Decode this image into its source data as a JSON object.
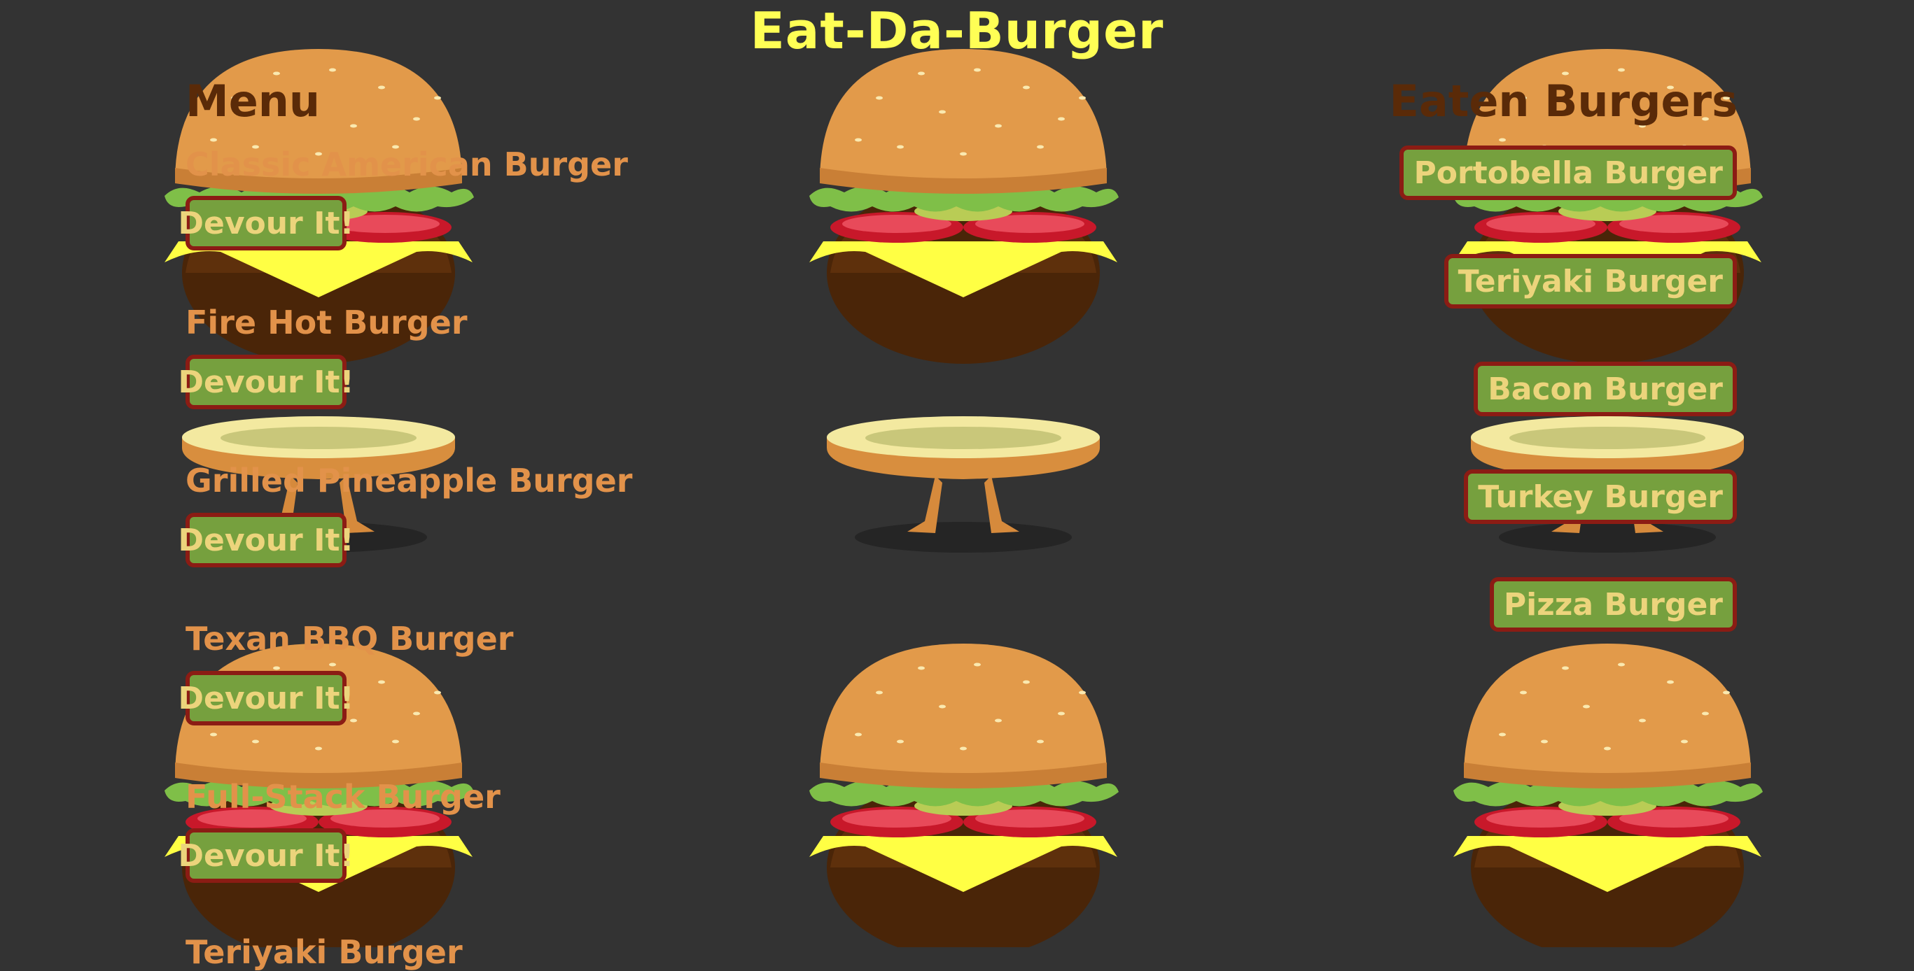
{
  "app_title": "Eat-Da-Burger",
  "menu": {
    "heading": "Menu",
    "devour_label": "Devour It!",
    "items": [
      {
        "name": "Classic American Burger"
      },
      {
        "name": "Fire Hot Burger"
      },
      {
        "name": "Grilled Pineapple Burger"
      },
      {
        "name": "Texan BBQ Burger"
      },
      {
        "name": "Full-Stack Burger"
      },
      {
        "name": "Teriyaki Burger"
      }
    ]
  },
  "eaten": {
    "heading": "Eaten Burgers",
    "items": [
      {
        "name": "Portobella Burger"
      },
      {
        "name": "Teriyaki Burger"
      },
      {
        "name": "Bacon Burger"
      },
      {
        "name": "Turkey Burger"
      },
      {
        "name": "Pizza Burger"
      }
    ]
  },
  "colors": {
    "background": "#333333",
    "title": "#FFFF55",
    "menu_text": "#e2924a",
    "button_fill": "#76a03e",
    "button_border": "#8b1c14",
    "button_text": "#ecd47c"
  }
}
